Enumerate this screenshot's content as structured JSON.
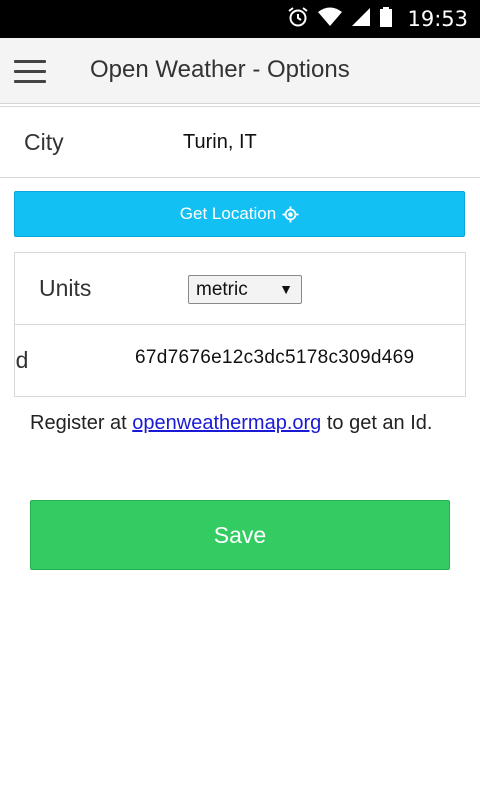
{
  "status_bar": {
    "time": "19:53",
    "icons": [
      "alarm-icon",
      "wifi-icon",
      "signal-icon",
      "battery-icon"
    ]
  },
  "app_bar": {
    "title": "Open Weather - Options",
    "menu_icon": "hamburger-menu-icon"
  },
  "city": {
    "label": "City",
    "value": "Turin, IT"
  },
  "get_location": {
    "label": "Get Location",
    "icon": "location-target-icon",
    "color": "#12c0f3"
  },
  "units": {
    "label": "Units",
    "selected": "metric"
  },
  "app_id": {
    "label": "p Id",
    "value": "67d7676e12c3dc5178c309d469"
  },
  "register": {
    "prefix": "Register at ",
    "link": "openweathermap.org",
    "suffix": " to get an Id."
  },
  "save": {
    "label": "Save",
    "color": "#33cc62"
  }
}
